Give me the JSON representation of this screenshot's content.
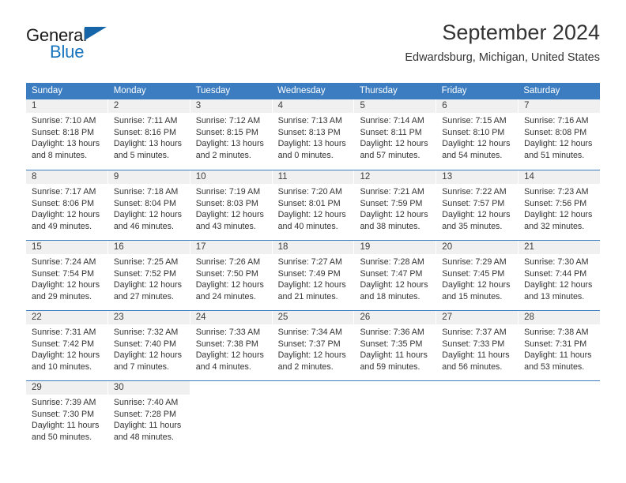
{
  "brand": {
    "name_part1": "General",
    "name_part2": "Blue",
    "triangle_icon": "triangle-icon",
    "accent_blue": "#1874bd"
  },
  "header": {
    "title": "September 2024",
    "subtitle": "Edwardsburg, Michigan, United States"
  },
  "colors": {
    "header_row": "#3b7dc0",
    "daynum_band": "#f0f0f0",
    "text": "#333333"
  },
  "weekday_headers": [
    "Sunday",
    "Monday",
    "Tuesday",
    "Wednesday",
    "Thursday",
    "Friday",
    "Saturday"
  ],
  "weeks": [
    [
      {
        "day": "1",
        "sunrise": "Sunrise: 7:10 AM",
        "sunset": "Sunset: 8:18 PM",
        "daylight1": "Daylight: 13 hours",
        "daylight2": "and 8 minutes."
      },
      {
        "day": "2",
        "sunrise": "Sunrise: 7:11 AM",
        "sunset": "Sunset: 8:16 PM",
        "daylight1": "Daylight: 13 hours",
        "daylight2": "and 5 minutes."
      },
      {
        "day": "3",
        "sunrise": "Sunrise: 7:12 AM",
        "sunset": "Sunset: 8:15 PM",
        "daylight1": "Daylight: 13 hours",
        "daylight2": "and 2 minutes."
      },
      {
        "day": "4",
        "sunrise": "Sunrise: 7:13 AM",
        "sunset": "Sunset: 8:13 PM",
        "daylight1": "Daylight: 13 hours",
        "daylight2": "and 0 minutes."
      },
      {
        "day": "5",
        "sunrise": "Sunrise: 7:14 AM",
        "sunset": "Sunset: 8:11 PM",
        "daylight1": "Daylight: 12 hours",
        "daylight2": "and 57 minutes."
      },
      {
        "day": "6",
        "sunrise": "Sunrise: 7:15 AM",
        "sunset": "Sunset: 8:10 PM",
        "daylight1": "Daylight: 12 hours",
        "daylight2": "and 54 minutes."
      },
      {
        "day": "7",
        "sunrise": "Sunrise: 7:16 AM",
        "sunset": "Sunset: 8:08 PM",
        "daylight1": "Daylight: 12 hours",
        "daylight2": "and 51 minutes."
      }
    ],
    [
      {
        "day": "8",
        "sunrise": "Sunrise: 7:17 AM",
        "sunset": "Sunset: 8:06 PM",
        "daylight1": "Daylight: 12 hours",
        "daylight2": "and 49 minutes."
      },
      {
        "day": "9",
        "sunrise": "Sunrise: 7:18 AM",
        "sunset": "Sunset: 8:04 PM",
        "daylight1": "Daylight: 12 hours",
        "daylight2": "and 46 minutes."
      },
      {
        "day": "10",
        "sunrise": "Sunrise: 7:19 AM",
        "sunset": "Sunset: 8:03 PM",
        "daylight1": "Daylight: 12 hours",
        "daylight2": "and 43 minutes."
      },
      {
        "day": "11",
        "sunrise": "Sunrise: 7:20 AM",
        "sunset": "Sunset: 8:01 PM",
        "daylight1": "Daylight: 12 hours",
        "daylight2": "and 40 minutes."
      },
      {
        "day": "12",
        "sunrise": "Sunrise: 7:21 AM",
        "sunset": "Sunset: 7:59 PM",
        "daylight1": "Daylight: 12 hours",
        "daylight2": "and 38 minutes."
      },
      {
        "day": "13",
        "sunrise": "Sunrise: 7:22 AM",
        "sunset": "Sunset: 7:57 PM",
        "daylight1": "Daylight: 12 hours",
        "daylight2": "and 35 minutes."
      },
      {
        "day": "14",
        "sunrise": "Sunrise: 7:23 AM",
        "sunset": "Sunset: 7:56 PM",
        "daylight1": "Daylight: 12 hours",
        "daylight2": "and 32 minutes."
      }
    ],
    [
      {
        "day": "15",
        "sunrise": "Sunrise: 7:24 AM",
        "sunset": "Sunset: 7:54 PM",
        "daylight1": "Daylight: 12 hours",
        "daylight2": "and 29 minutes."
      },
      {
        "day": "16",
        "sunrise": "Sunrise: 7:25 AM",
        "sunset": "Sunset: 7:52 PM",
        "daylight1": "Daylight: 12 hours",
        "daylight2": "and 27 minutes."
      },
      {
        "day": "17",
        "sunrise": "Sunrise: 7:26 AM",
        "sunset": "Sunset: 7:50 PM",
        "daylight1": "Daylight: 12 hours",
        "daylight2": "and 24 minutes."
      },
      {
        "day": "18",
        "sunrise": "Sunrise: 7:27 AM",
        "sunset": "Sunset: 7:49 PM",
        "daylight1": "Daylight: 12 hours",
        "daylight2": "and 21 minutes."
      },
      {
        "day": "19",
        "sunrise": "Sunrise: 7:28 AM",
        "sunset": "Sunset: 7:47 PM",
        "daylight1": "Daylight: 12 hours",
        "daylight2": "and 18 minutes."
      },
      {
        "day": "20",
        "sunrise": "Sunrise: 7:29 AM",
        "sunset": "Sunset: 7:45 PM",
        "daylight1": "Daylight: 12 hours",
        "daylight2": "and 15 minutes."
      },
      {
        "day": "21",
        "sunrise": "Sunrise: 7:30 AM",
        "sunset": "Sunset: 7:44 PM",
        "daylight1": "Daylight: 12 hours",
        "daylight2": "and 13 minutes."
      }
    ],
    [
      {
        "day": "22",
        "sunrise": "Sunrise: 7:31 AM",
        "sunset": "Sunset: 7:42 PM",
        "daylight1": "Daylight: 12 hours",
        "daylight2": "and 10 minutes."
      },
      {
        "day": "23",
        "sunrise": "Sunrise: 7:32 AM",
        "sunset": "Sunset: 7:40 PM",
        "daylight1": "Daylight: 12 hours",
        "daylight2": "and 7 minutes."
      },
      {
        "day": "24",
        "sunrise": "Sunrise: 7:33 AM",
        "sunset": "Sunset: 7:38 PM",
        "daylight1": "Daylight: 12 hours",
        "daylight2": "and 4 minutes."
      },
      {
        "day": "25",
        "sunrise": "Sunrise: 7:34 AM",
        "sunset": "Sunset: 7:37 PM",
        "daylight1": "Daylight: 12 hours",
        "daylight2": "and 2 minutes."
      },
      {
        "day": "26",
        "sunrise": "Sunrise: 7:36 AM",
        "sunset": "Sunset: 7:35 PM",
        "daylight1": "Daylight: 11 hours",
        "daylight2": "and 59 minutes."
      },
      {
        "day": "27",
        "sunrise": "Sunrise: 7:37 AM",
        "sunset": "Sunset: 7:33 PM",
        "daylight1": "Daylight: 11 hours",
        "daylight2": "and 56 minutes."
      },
      {
        "day": "28",
        "sunrise": "Sunrise: 7:38 AM",
        "sunset": "Sunset: 7:31 PM",
        "daylight1": "Daylight: 11 hours",
        "daylight2": "and 53 minutes."
      }
    ],
    [
      {
        "day": "29",
        "sunrise": "Sunrise: 7:39 AM",
        "sunset": "Sunset: 7:30 PM",
        "daylight1": "Daylight: 11 hours",
        "daylight2": "and 50 minutes."
      },
      {
        "day": "30",
        "sunrise": "Sunrise: 7:40 AM",
        "sunset": "Sunset: 7:28 PM",
        "daylight1": "Daylight: 11 hours",
        "daylight2": "and 48 minutes."
      },
      {
        "day": "",
        "sunrise": "",
        "sunset": "",
        "daylight1": "",
        "daylight2": ""
      },
      {
        "day": "",
        "sunrise": "",
        "sunset": "",
        "daylight1": "",
        "daylight2": ""
      },
      {
        "day": "",
        "sunrise": "",
        "sunset": "",
        "daylight1": "",
        "daylight2": ""
      },
      {
        "day": "",
        "sunrise": "",
        "sunset": "",
        "daylight1": "",
        "daylight2": ""
      },
      {
        "day": "",
        "sunrise": "",
        "sunset": "",
        "daylight1": "",
        "daylight2": ""
      }
    ]
  ]
}
